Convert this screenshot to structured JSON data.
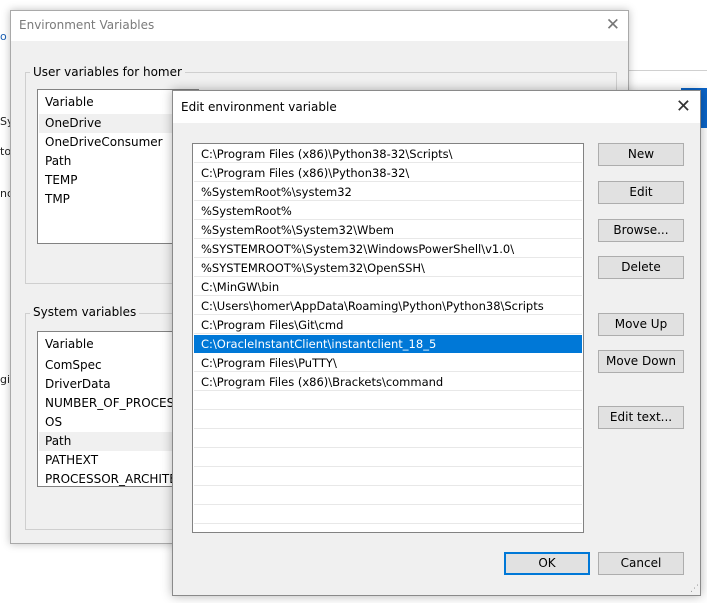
{
  "background_window": {
    "left_fragments": [
      "o",
      "Sys",
      "to",
      "nor",
      "gi"
    ]
  },
  "env_dialog": {
    "title": "Environment Variables",
    "close_glyph": "✕",
    "user_group_label": "User variables for homer",
    "user_list": {
      "header": "Variable",
      "rows": [
        "OneDrive",
        "OneDriveConsumer",
        "Path",
        "TEMP",
        "TMP"
      ]
    },
    "system_group_label": "System variables",
    "system_list": {
      "header": "Variable",
      "rows": [
        "ComSpec",
        "DriverData",
        "NUMBER_OF_PROCESSORS",
        "OS",
        "Path",
        "PATHEXT",
        "PROCESSOR_ARCHITECTURE"
      ]
    }
  },
  "edit_dialog": {
    "title": "Edit environment variable",
    "close_glyph": "✕",
    "paths": [
      "C:\\Program Files (x86)\\Python38-32\\Scripts\\",
      "C:\\Program Files (x86)\\Python38-32\\",
      "%SystemRoot%\\system32",
      "%SystemRoot%",
      "%SystemRoot%\\System32\\Wbem",
      "%SYSTEMROOT%\\System32\\WindowsPowerShell\\v1.0\\",
      "%SYSTEMROOT%\\System32\\OpenSSH\\",
      "C:\\MinGW\\bin",
      "C:\\Users\\homer\\AppData\\Roaming\\Python\\Python38\\Scripts",
      "C:\\Program Files\\Git\\cmd",
      "C:\\OracleInstantClient\\instantclient_18_5",
      "C:\\Program Files\\PuTTY\\",
      "C:\\Program Files (x86)\\Brackets\\command"
    ],
    "selected_index": 10,
    "buttons": {
      "new": "New",
      "edit": "Edit",
      "browse": "Browse...",
      "delete": "Delete",
      "move_up": "Move Up",
      "move_down": "Move Down",
      "edit_text": "Edit text...",
      "ok": "OK",
      "cancel": "Cancel"
    }
  },
  "colors": {
    "selection": "#0078d7",
    "dialog_bg": "#f0f0f0"
  }
}
